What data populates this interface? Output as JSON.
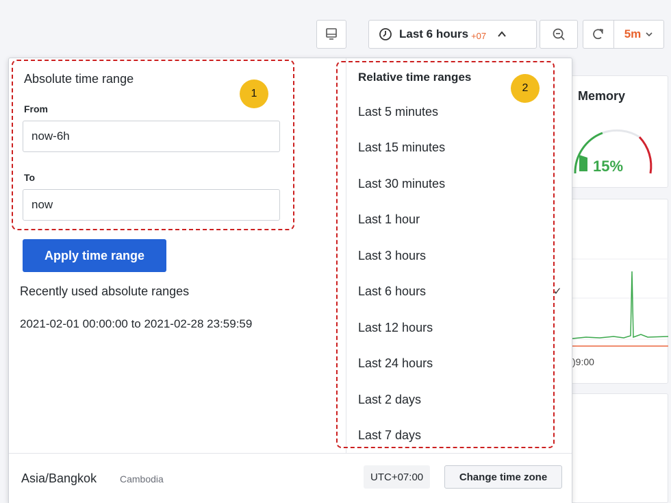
{
  "toolbar": {
    "time_range_label": "Last 6 hours",
    "time_zone_offset": "+07",
    "refresh_interval": "5m"
  },
  "background": {
    "memory_panel_title": "Memory",
    "memory_gauge_value": "15%",
    "graph_time_label": ")9:00"
  },
  "absolute_range": {
    "title": "Absolute time range",
    "from_label": "From",
    "from_value": "now-6h",
    "to_label": "To",
    "to_value": "now",
    "apply_button": "Apply time range"
  },
  "recent": {
    "title": "Recently used absolute ranges",
    "items": [
      "2021-02-01 00:00:00 to 2021-02-28 23:59:59"
    ]
  },
  "relative": {
    "title": "Relative time ranges",
    "items": [
      "Last 5 minutes",
      "Last 15 minutes",
      "Last 30 minutes",
      "Last 1 hour",
      "Last 3 hours",
      "Last 6 hours",
      "Last 12 hours",
      "Last 24 hours",
      "Last 2 days",
      "Last 7 days"
    ],
    "selected": "Last 6 hours"
  },
  "footer": {
    "timezone": "Asia/Bangkok",
    "country": "Cambodia",
    "utc_offset": "UTC+07:00",
    "change_button": "Change time zone"
  },
  "annotations": {
    "badge_1": "1",
    "badge_2": "2",
    "color": "#cc1f1f",
    "badge_color": "#f3bd1d"
  }
}
